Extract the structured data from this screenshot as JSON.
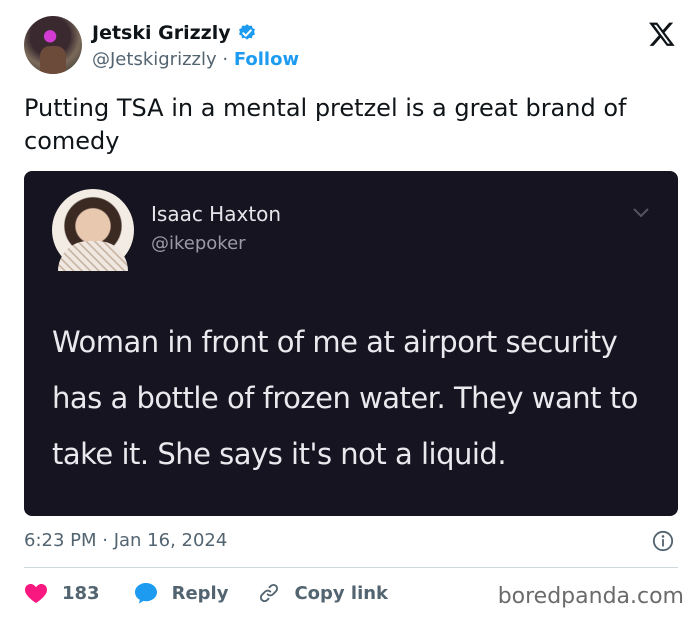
{
  "author": {
    "name": "Jetski Grizzly",
    "handle": "@Jetskigrizzly",
    "separator": "·",
    "follow_label": "Follow"
  },
  "tweet": {
    "text": "Putting TSA in a mental pretzel is a great brand of comedy"
  },
  "embedded": {
    "name": "Isaac Haxton",
    "handle": "@ikepoker",
    "text": "Woman in front of me at airport security has a bottle of frozen water. They want to take it. She says it's not a liquid."
  },
  "meta": {
    "timestamp": "6:23 PM · Jan 16, 2024"
  },
  "actions": {
    "likes": "183",
    "reply_label": "Reply",
    "copy_label": "Copy link"
  },
  "watermark": "boredpanda.com",
  "colors": {
    "accent": "#1d9bf0",
    "like": "#f91880",
    "embed_bg": "#161420"
  },
  "icons": [
    "verified-badge-icon",
    "x-logo-icon",
    "chevron-down-icon",
    "info-icon",
    "heart-icon",
    "reply-bubble-icon",
    "link-icon"
  ]
}
